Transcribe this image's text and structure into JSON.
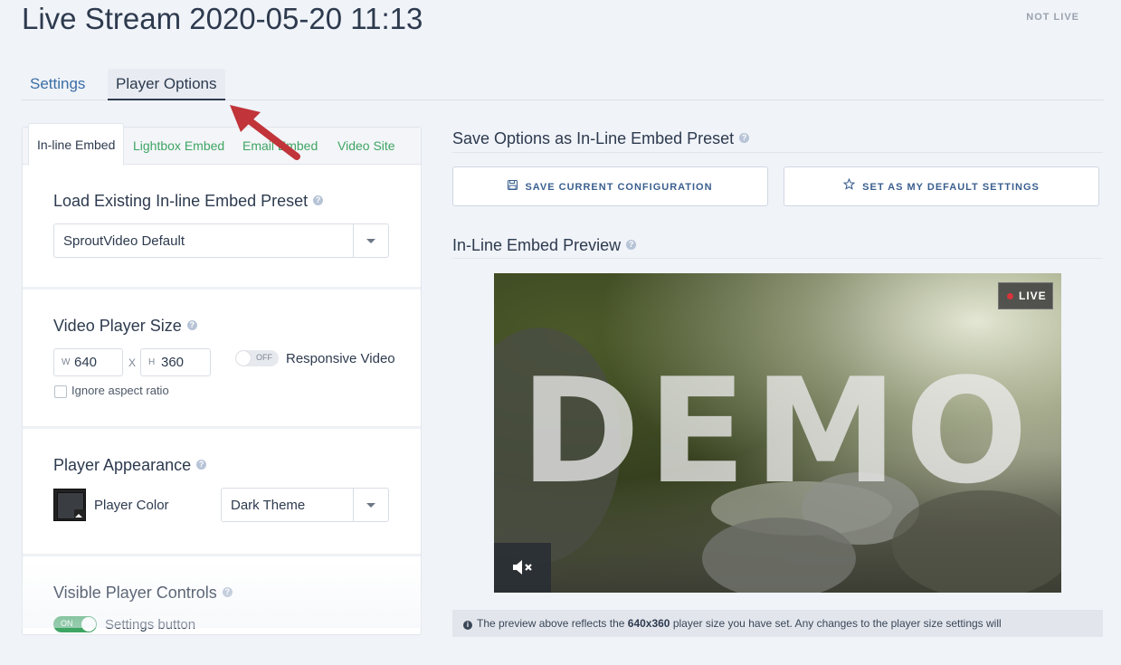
{
  "page": {
    "title": "Live Stream 2020-05-20 11:13",
    "status": "NOT LIVE"
  },
  "main_tabs": [
    {
      "label": "Settings",
      "active": false
    },
    {
      "label": "Player Options",
      "active": true
    }
  ],
  "sub_tabs": [
    {
      "label": "In-line Embed",
      "active": true
    },
    {
      "label": "Lightbox Embed",
      "active": false
    },
    {
      "label": "Email Embed",
      "active": false
    },
    {
      "label": "Video Site",
      "active": false
    }
  ],
  "preset": {
    "title": "Load Existing In-line Embed Preset",
    "selected": "SproutVideo Default"
  },
  "player_size": {
    "title": "Video Player Size",
    "width_label": "W",
    "width": "640",
    "separator": "X",
    "height_label": "H",
    "height": "360",
    "responsive_toggle": "OFF",
    "responsive_label": "Responsive Video",
    "ignore_aspect_label": "Ignore aspect ratio",
    "ignore_aspect_checked": false
  },
  "appearance": {
    "title": "Player Appearance",
    "color_label": "Player Color",
    "color": "#3a3d42",
    "theme": "Dark Theme"
  },
  "controls": {
    "title": "Visible Player Controls",
    "settings_toggle": "ON",
    "settings_label": "Settings button"
  },
  "save_section": {
    "title": "Save Options as In-Line Embed Preset",
    "save_button": "SAVE CURRENT CONFIGURATION",
    "default_button": "SET AS MY DEFAULT SETTINGS"
  },
  "preview": {
    "title": "In-Line Embed Preview",
    "watermark": "DEMO",
    "live_badge": "LIVE",
    "notice_pre": "The preview above reflects the ",
    "notice_size": "640x360",
    "notice_post": " player size you have set. Any changes to the player size settings will"
  },
  "colors": {
    "accent_green": "#3fa564",
    "link_blue": "#3a6ea5",
    "live_red": "#d8343a",
    "annotation_arrow": "#c0343a"
  }
}
